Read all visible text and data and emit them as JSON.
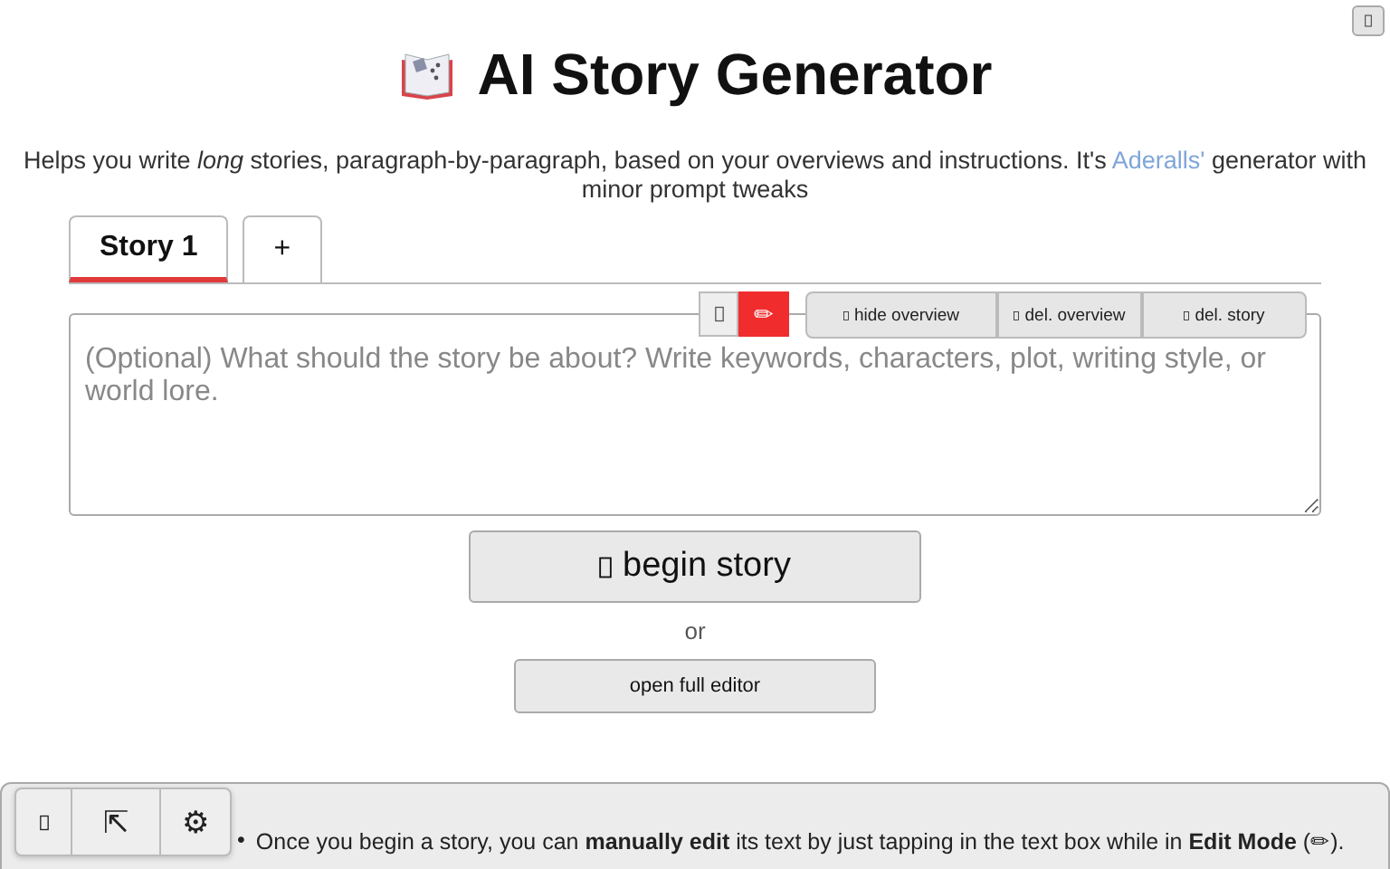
{
  "title": "AI Story Generator",
  "subtitle": {
    "before": "Helps you write *long* stories, paragraph-by-paragraph, based on your overviews and instructions. It's ",
    "link": "Aderalls'",
    "after": " generator with minor prompt tweaks"
  },
  "tabs": [
    {
      "label": "Story 1",
      "selected": true
    },
    {
      "label": "+",
      "selected": false
    }
  ],
  "overview_toolbar": {
    "mode_buttons": [
      {
        "kind": "icon",
        "selected": false
      },
      {
        "kind": "text",
        "label": "✏",
        "selected": true
      }
    ],
    "buttons": [
      "hide overview",
      "del. overview",
      "del. story"
    ]
  },
  "overview": {
    "placeholder": "(Optional) What should the story be about? Write keywords, characters, plot, writing style, or world lore."
  },
  "begin_button": "begin story",
  "or_text": "or",
  "editor_button": "open full editor",
  "floating_toolbar": [
    {
      "kind": "icon"
    },
    {
      "kind": "text",
      "label": "⇱"
    },
    {
      "kind": "text",
      "label": "⚙"
    }
  ],
  "tips": [
    {
      "marker": "•",
      "text": "Once you begin a story, you can **manually edit** its text by just tapping in the text box while in **Edit Mode** (✏)."
    }
  ]
}
